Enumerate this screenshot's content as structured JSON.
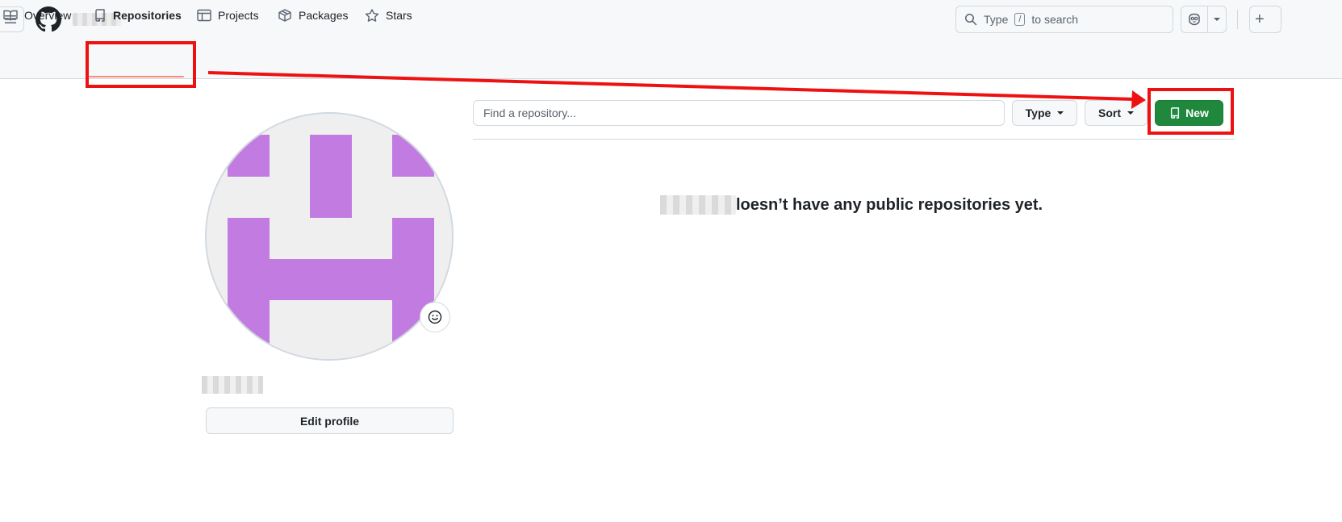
{
  "header": {
    "search": {
      "prefix": "Type",
      "key": "/",
      "suffix": "to search"
    }
  },
  "tabs": [
    {
      "label": "Overview",
      "icon": "book-icon"
    },
    {
      "label": "Repositories",
      "icon": "repo-icon",
      "active": true
    },
    {
      "label": "Projects",
      "icon": "table-icon"
    },
    {
      "label": "Packages",
      "icon": "package-icon"
    },
    {
      "label": "Stars",
      "icon": "star-icon"
    }
  ],
  "sidebar": {
    "edit_profile_label": "Edit profile"
  },
  "repos": {
    "find_placeholder": "Find a repository...",
    "type_label": "Type",
    "sort_label": "Sort",
    "new_label": "New",
    "blankslate_text": "loesn’t have any public repositories yet."
  },
  "colors": {
    "accent_green": "#1f883d",
    "avatar_purple": "#c27be0",
    "annotation_red": "#ee1111",
    "tab_underline": "#fd8c73"
  }
}
